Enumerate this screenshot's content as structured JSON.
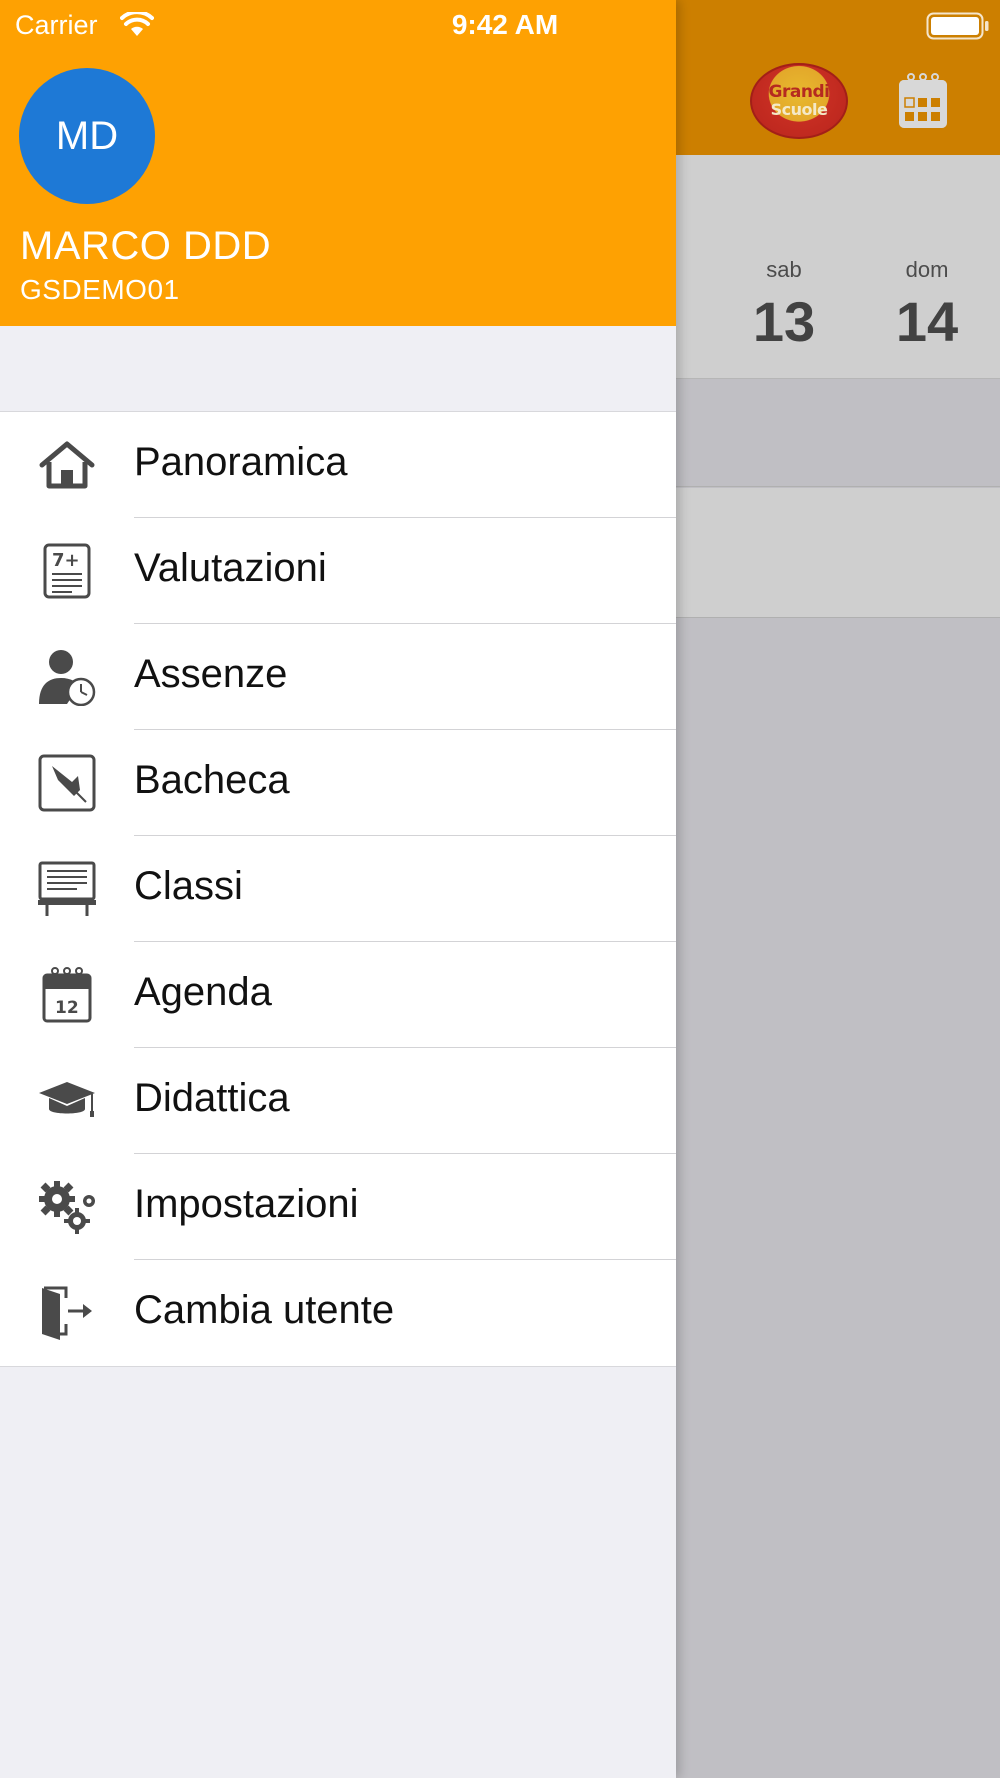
{
  "status_bar": {
    "carrier": "Carrier",
    "time": "9:42 AM"
  },
  "drawer": {
    "header_color": "#fea102",
    "avatar": {
      "initials": "MD",
      "color": "#1e79d6"
    },
    "user_name": "MARCO DDD",
    "user_code": "GSDEMO01",
    "menu": [
      {
        "label": "Panoramica",
        "icon": "home-icon"
      },
      {
        "label": "Valutazioni",
        "icon": "grades-icon"
      },
      {
        "label": "Assenze",
        "icon": "absence-icon"
      },
      {
        "label": "Bacheca",
        "icon": "pin-board-icon"
      },
      {
        "label": "Classi",
        "icon": "classroom-board-icon"
      },
      {
        "label": "Agenda",
        "icon": "calendar-icon"
      },
      {
        "label": "Didattica",
        "icon": "graduation-cap-icon"
      },
      {
        "label": "Impostazioni",
        "icon": "gears-icon"
      },
      {
        "label": "Cambia utente",
        "icon": "logout-door-icon"
      }
    ]
  },
  "background_app": {
    "logo_text_line1": "Grandi",
    "logo_text_line2": "Scuole",
    "week_days": [
      {
        "name": "sab",
        "number": "13"
      },
      {
        "name": "dom",
        "number": "14"
      }
    ]
  }
}
